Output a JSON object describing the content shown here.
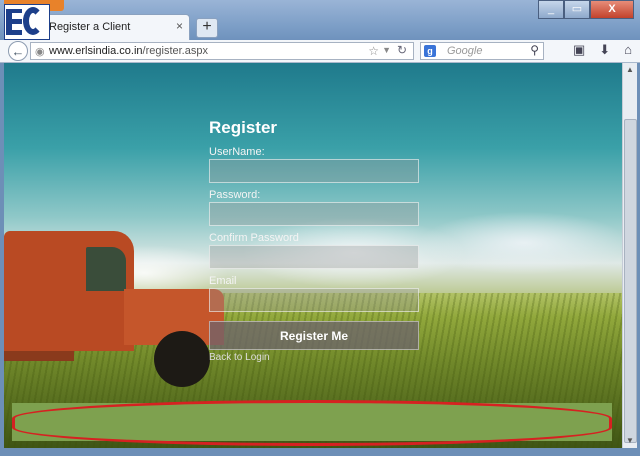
{
  "browser": {
    "tab_label": "Register a Client",
    "tab_close": "×",
    "new_tab": "+",
    "url_host": "www.erlsindia.co.in",
    "url_path": "/register.aspx",
    "search_placeholder": "Google",
    "search_engine_badge": "g",
    "window_buttons": [
      "_",
      "▭",
      "X"
    ]
  },
  "page": {
    "title": "Register",
    "labels": {
      "username": "UserName:",
      "password": "Password:",
      "confirm_password": "Confirm Password",
      "email": "Email"
    },
    "submit_label": "Register Me",
    "back_link": "Back to Login"
  },
  "colors": {
    "footer_band": "#7ea14f",
    "highlight_ring": "#d62121",
    "title_text": "#ffffff"
  },
  "icons": [
    "back-arrow-icon",
    "globe-icon",
    "bookmark-star-icon",
    "reload-icon",
    "search-icon",
    "download-icon",
    "home-icon"
  ]
}
